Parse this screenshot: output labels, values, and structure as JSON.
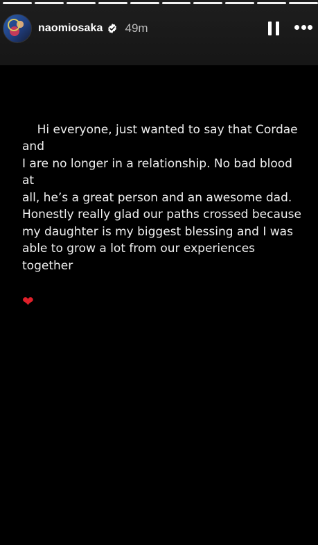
{
  "progress_segments": 10,
  "header": {
    "username": "naomiosaka",
    "timestamp": "49m"
  },
  "story": {
    "text": "Hi everyone, just wanted to say that Cordae and\nI are no longer in a relationship. No bad blood at\nall, he’s a great person and an awesome dad.\nHonestly really glad our paths crossed because\nmy daughter is my biggest blessing and I was\nable to grow a lot from our experiences together",
    "emoji": "❤"
  },
  "icons": {
    "verified": "verified-badge-icon",
    "pause": "pause-icon",
    "more": "more-options-icon"
  },
  "colors": {
    "heart": "#e0202a",
    "background": "#000000"
  }
}
